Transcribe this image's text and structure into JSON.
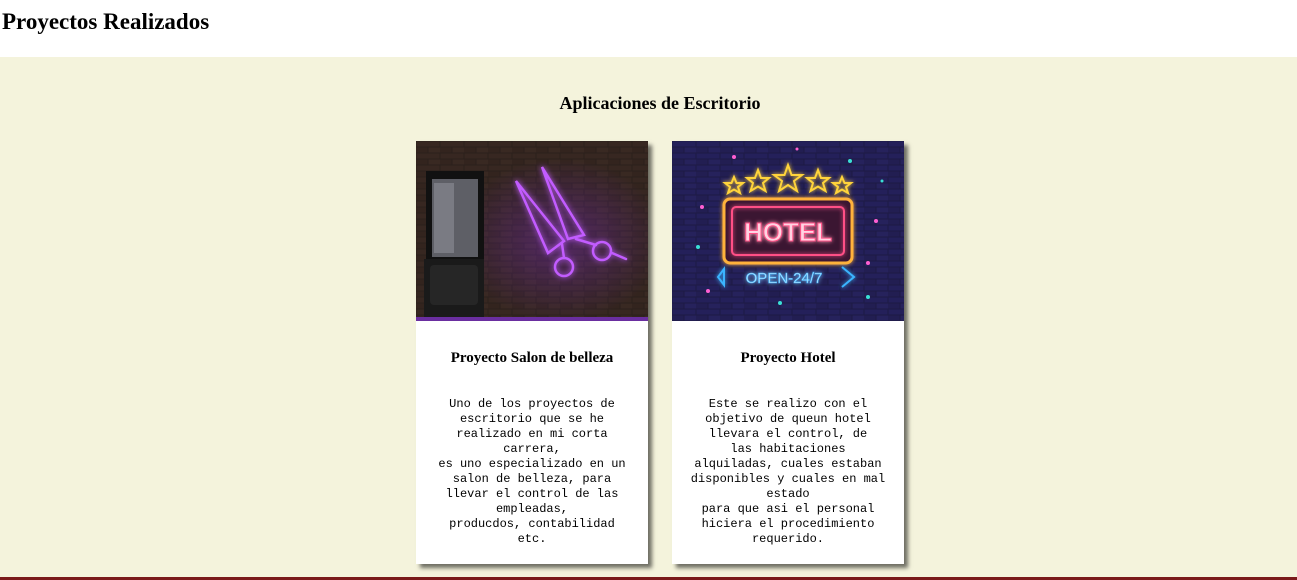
{
  "page": {
    "title": "Proyectos Realizados"
  },
  "section": {
    "title": "Aplicaciones de Escritorio"
  },
  "projects": [
    {
      "title": "Proyecto Salon de belleza",
      "description": "Uno de los proyectos de\nescritorio que se he\nrealizado en mi corta\ncarrera,\nes uno especializado en un\nsalon de belleza, para\nllevar el control de las\nempleadas,\nproducdos, contabilidad\netc.",
      "image": "neon-scissors-image"
    },
    {
      "title": "Proyecto Hotel",
      "description": "Este se realizo con el\nobjetivo de queun hotel\nllevara el control, de\nlas habitaciones\nalquiladas, cuales estaban\ndisponibles y cuales en mal\nestado\npara que asi el personal\nhiciera el procedimiento\nrequerido.",
      "image": "neon-hotel-sign-image",
      "sign_text": "HOTEL",
      "sign_subtext": "OPEN-24/7"
    }
  ],
  "colors": {
    "section_background": "#f4f3dc",
    "bottom_bar": "#7a1a1a"
  }
}
